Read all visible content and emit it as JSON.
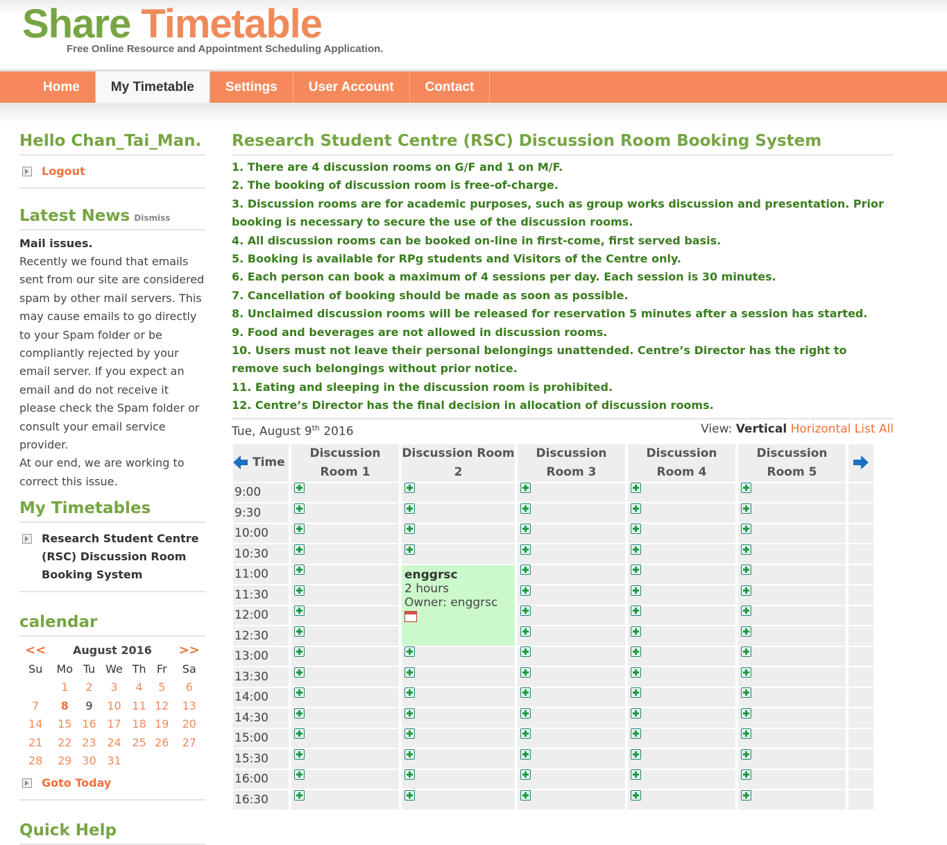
{
  "site": {
    "logo_word1": "Share",
    "logo_word2": "Timetable",
    "tagline": "Free Online Resource and Appointment Scheduling Application."
  },
  "nav": {
    "items": [
      {
        "label": "Home"
      },
      {
        "label": "My Timetable",
        "active": true
      },
      {
        "label": "Settings"
      },
      {
        "label": "User Account"
      },
      {
        "label": "Contact"
      }
    ]
  },
  "sidebar": {
    "greeting": "Hello Chan_Tai_Man.",
    "logout": "Logout",
    "news_heading": "Latest News",
    "dismiss": "Dismiss",
    "news_title": "Mail issues.",
    "news_body": "Recently we found that emails sent from our site are considered spam by other mail servers. This may cause emails to go directly to your Spam folder or be compliantly rejected by your email server. If you expect an email and do not receive it please check the Spam folder or consult your email service provider.",
    "news_body2": "At our end, we are working to correct this issue.",
    "timetables_heading": "My Timetables",
    "timetable_link": "Research Student Centre (RSC) Discussion Room Booking System",
    "calendar_heading": "calendar",
    "calendar": {
      "prev": "<<",
      "next": ">>",
      "month": "August 2016",
      "weekdays": [
        "Su",
        "Mo",
        "Tu",
        "We",
        "Th",
        "Fr",
        "Sa"
      ],
      "today": "8",
      "selected": "9"
    },
    "goto_today": "Goto Today",
    "quick_help": "Quick Help"
  },
  "main": {
    "title": "Research Student Centre (RSC) Discussion Room Booking System",
    "rules": [
      "1. There are 4 discussion rooms on G/F and 1 on M/F.",
      "2. The booking of discussion room is free-of-charge.",
      "3. Discussion rooms are for academic purposes, such as group works discussion and presentation. Prior booking is necessary to secure the use of the discussion rooms.",
      "4. All discussion rooms can be booked on-line in first-come, first served basis.",
      "5. Booking is available for RPg students and Visitors of the Centre only.",
      "6. Each person can book a maximum of 4 sessions per day. Each session is 30 minutes.",
      "7. Cancellation of booking should be made as soon as possible.",
      "8. Unclaimed discussion rooms will be released for reservation 5 minutes after a session has started.",
      "9. Food and beverages are not allowed in discussion rooms.",
      "10. Users must not leave their personal belongings unattended. Centre’s Director has the right to remove such belongings without prior notice.",
      "11. Eating and sleeping in the discussion room is prohibited.",
      "12. Centre’s Director has the final decision in allocation of discussion rooms."
    ],
    "date_prefix": "Tue, August 9",
    "date_suffix": "th",
    "date_year": "2016",
    "view_label": "View:",
    "view_current": "Vertical",
    "view_horizontal": "Horizontal",
    "view_list": "List All",
    "time_header": "Time",
    "rooms": [
      "Discussion Room 1",
      "Discussion Room 2",
      "Discussion Room 3",
      "Discussion Room 4",
      "Discussion Room 5"
    ],
    "times": [
      "9:00",
      "9:30",
      "10:00",
      "10:30",
      "11:00",
      "11:30",
      "12:00",
      "12:30",
      "13:00",
      "13:30",
      "14:00",
      "14:30",
      "15:00",
      "15:30",
      "16:00",
      "16:30"
    ],
    "booking": {
      "room_index": 1,
      "start_index": 4,
      "slots": 4,
      "user": "enggrsc",
      "duration": "2 hours",
      "owner": "Owner: enggrsc"
    }
  }
}
